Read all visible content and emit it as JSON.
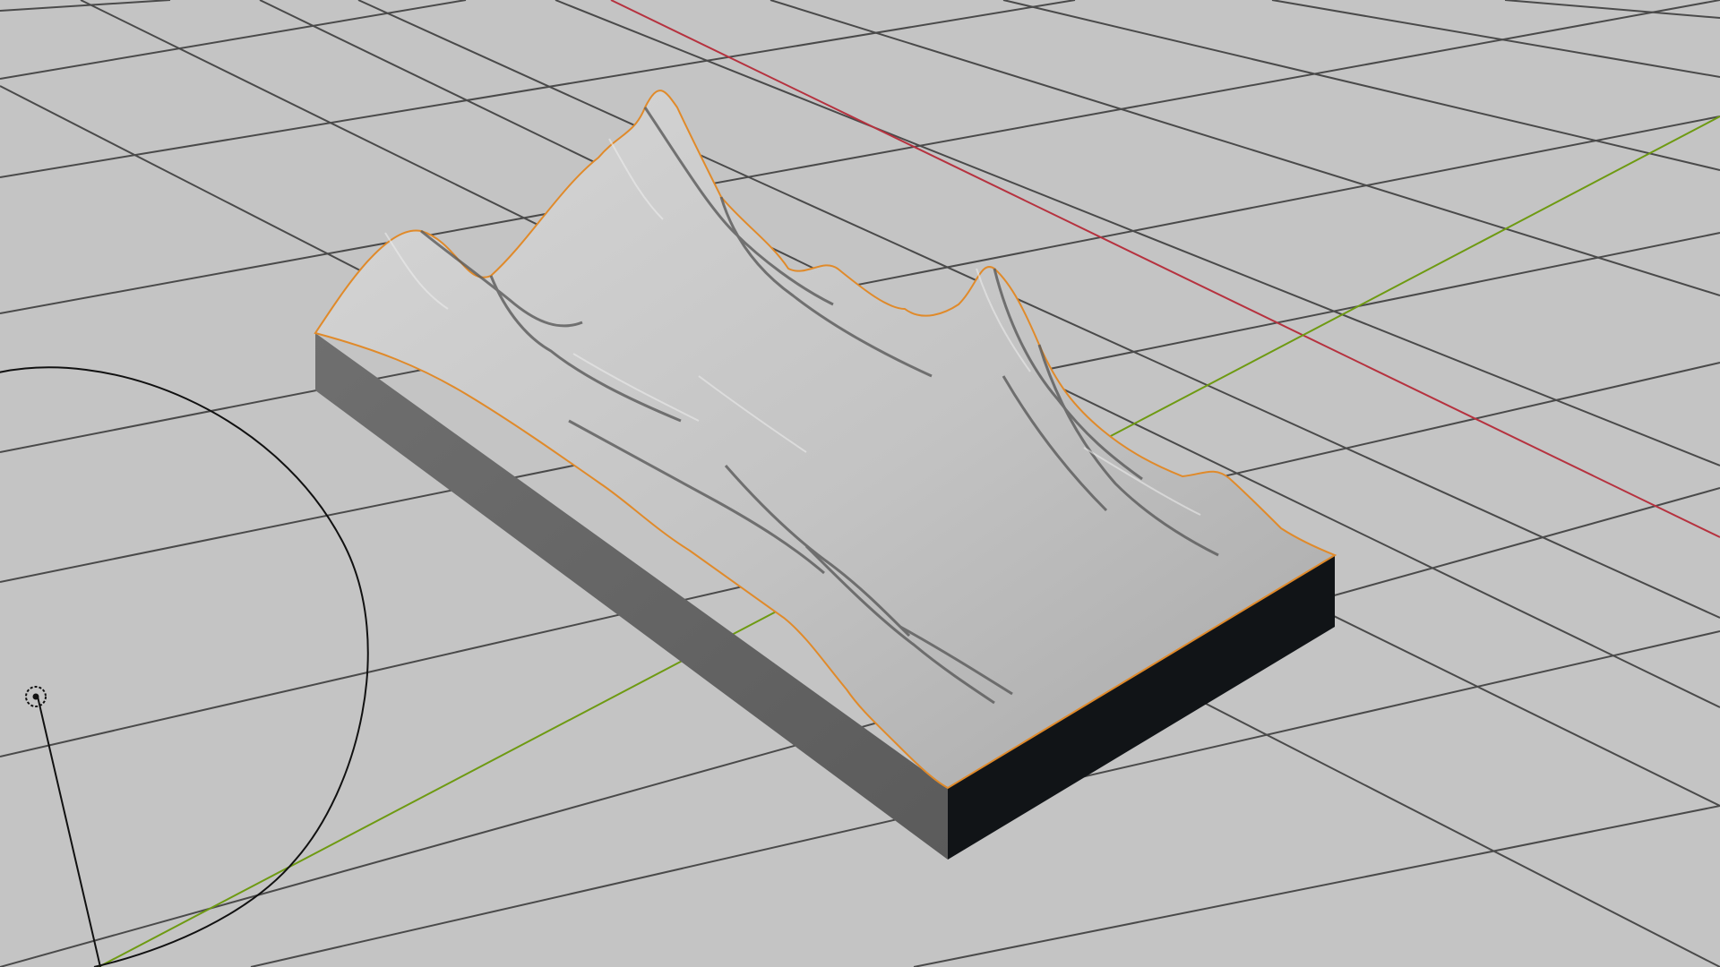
{
  "viewport": {
    "background": "#c4c4c4",
    "grid_color": "#4a4a4a",
    "x_axis_color": "#b6323f",
    "y_axis_color": "#6e9a12"
  },
  "terrain": {
    "top_color": "#bdbdbd",
    "shadow_color": "#5a5a5a",
    "side_lit_color": "#6b6b6b",
    "side_dark_color": "#111417",
    "selection_outline_color": "#e08a2a"
  },
  "light": {
    "icon": "light-icon",
    "line_color": "#111111"
  }
}
